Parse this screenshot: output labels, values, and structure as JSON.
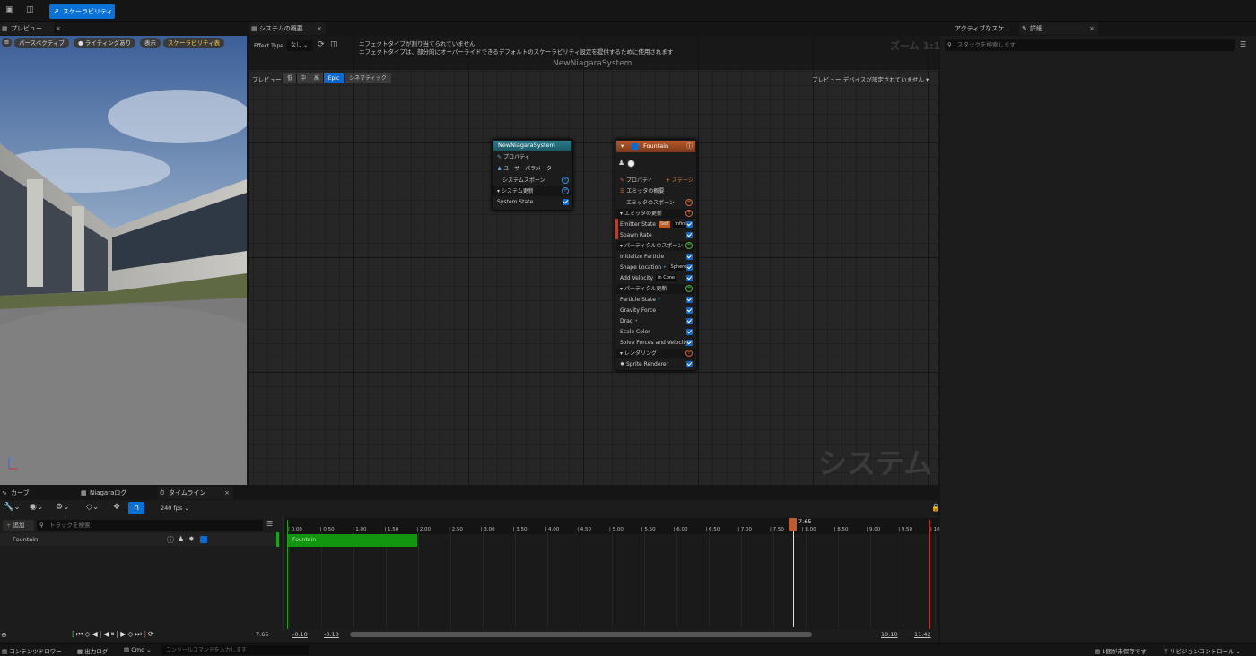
{
  "toolbar": {
    "scalability_button": "スケーラビリティ"
  },
  "tabs": {
    "preview": "プレビュー",
    "system_overview": "システムの概要",
    "active_stack": "アクティブなスケ...",
    "details": "詳細",
    "curves": "カーブ",
    "niagara_log": "Niagaraログ",
    "timeline": "タイムライン"
  },
  "preview_pills": {
    "perspective": "パースペクティブ",
    "lighting": "ライティングあり",
    "show": "表示",
    "scalability": "スケーラビリティ表"
  },
  "overview": {
    "effect_type_label": "Effect Type",
    "effect_type_value": "なし",
    "warning_line1": "エフェクトタイプが割り当てられていません",
    "warning_line2": "エフェクトタイプは、部分的にオーバーライドできるデフォルトのスケーラビリティ設定を提供するために使用されます",
    "zoom": "ズーム 1:1",
    "system_name": "NewNiagaraSystem",
    "preview_label": "プレビュー",
    "quality_levels": [
      "低",
      "中",
      "高",
      "Epic",
      "シネマティック"
    ],
    "device_label": "プレビュー デバイスが設定されていません",
    "watermark": "システム"
  },
  "system_node": {
    "title": "NewNiagaraSystem",
    "rows": [
      "プロパティ",
      "ユーザーパラメータ",
      "システムスポーン",
      "システム更新",
      "System State"
    ]
  },
  "emitter_node": {
    "title": "Fountain",
    "properties": "プロパティ",
    "stage": "ステージ",
    "summary": "エミッタの概要",
    "emitter_spawn": "エミッタのスポーン",
    "emitter_update": "エミッタの更新",
    "emitter_state": "Emitter State",
    "self_tag": "Self",
    "infinite_tag": "Infinite",
    "spawn_rate": "Spawn Rate",
    "particle_spawn": "パーティクルのスポーン",
    "initialize_particle": "Initialize Particle",
    "shape_location": "Shape Location",
    "sphere_tag": "Sphere",
    "add_velocity": "Add Velocity",
    "cone_tag": "in Cone",
    "particle_update": "パーティクル更新",
    "particle_state": "Particle State",
    "gravity_force": "Gravity Force",
    "drag": "Drag",
    "scale_color": "Scale Color",
    "solve_forces": "Solve Forces and Velocity",
    "rendering": "レンダリング",
    "sprite_renderer": "Sprite Renderer"
  },
  "details": {
    "search_placeholder": "スタックを検索します"
  },
  "timeline": {
    "fps": "240 fps",
    "add": "追加",
    "search_placeholder": "トラックを検索",
    "track": "Fountain",
    "playhead": "7.65",
    "ticks": [
      "0.00",
      "0.50",
      "1.00",
      "1.50",
      "2.00",
      "2.50",
      "3.00",
      "3.50",
      "4.00",
      "4.50",
      "5.00",
      "5.50",
      "6.00",
      "6.50",
      "7.00",
      "7.50",
      "8.00",
      "8.50",
      "9.00",
      "9.50",
      "10"
    ],
    "current_time": "7.65",
    "range_start": "-0.10",
    "range_start2": "-0.10",
    "range_end": "10.10",
    "range_end2": "11.42",
    "bar_label": "Fountain"
  },
  "statusbar": {
    "content_drawer": "コンテンツドロワー",
    "output_log": "出力ログ",
    "cmd": "Cmd",
    "console_placeholder": "コンソールコマンドを入力します",
    "unsaved": "1個が未保存です",
    "revision": "リビジョンコントロール"
  }
}
